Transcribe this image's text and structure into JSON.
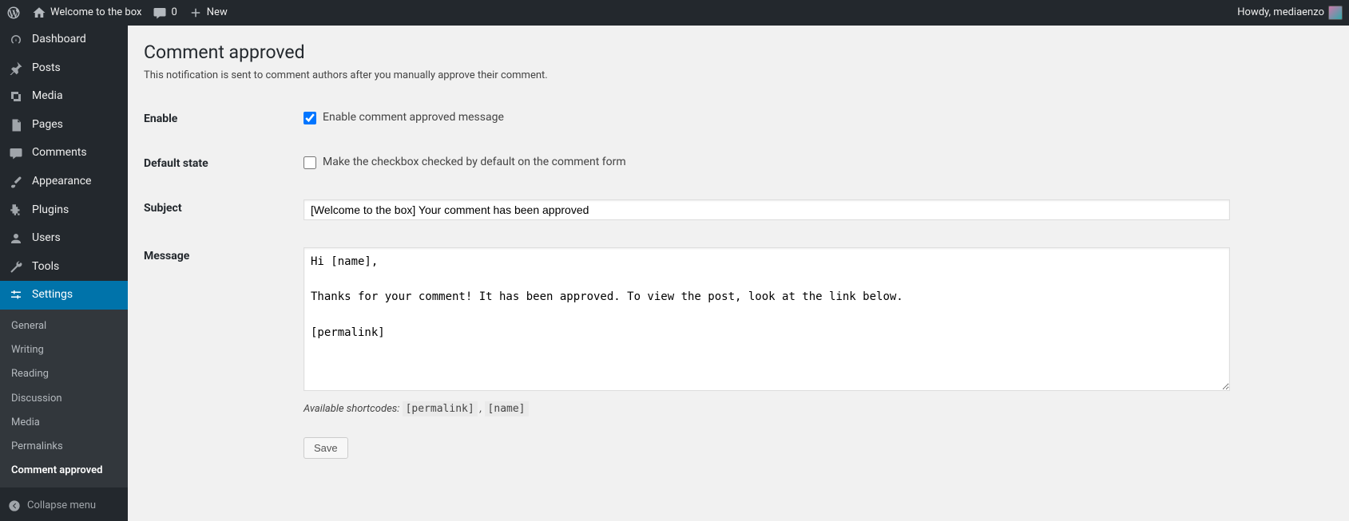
{
  "adminbar": {
    "site_name": "Welcome to the box",
    "comments_count": "0",
    "new_label": "New",
    "howdy_prefix": "Howdy, ",
    "user_name": "mediaenzo"
  },
  "sidebar": {
    "items": [
      {
        "key": "dashboard",
        "label": "Dashboard"
      },
      {
        "key": "posts",
        "label": "Posts"
      },
      {
        "key": "media",
        "label": "Media"
      },
      {
        "key": "pages",
        "label": "Pages"
      },
      {
        "key": "comments",
        "label": "Comments"
      },
      {
        "key": "appearance",
        "label": "Appearance"
      },
      {
        "key": "plugins",
        "label": "Plugins"
      },
      {
        "key": "users",
        "label": "Users"
      },
      {
        "key": "tools",
        "label": "Tools"
      },
      {
        "key": "settings",
        "label": "Settings"
      }
    ],
    "settings_submenu": [
      {
        "key": "general",
        "label": "General"
      },
      {
        "key": "writing",
        "label": "Writing"
      },
      {
        "key": "reading",
        "label": "Reading"
      },
      {
        "key": "discussion",
        "label": "Discussion"
      },
      {
        "key": "media",
        "label": "Media"
      },
      {
        "key": "permalinks",
        "label": "Permalinks"
      },
      {
        "key": "comment-approved",
        "label": "Comment approved"
      }
    ],
    "collapse_label": "Collapse menu"
  },
  "page": {
    "title": "Comment approved",
    "description": "This notification is sent to comment authors after you manually approve their comment.",
    "labels": {
      "enable": "Enable",
      "default_state": "Default state",
      "subject": "Subject",
      "message": "Message"
    },
    "fields": {
      "enable_checkbox_label": "Enable comment approved message",
      "enable_checked": true,
      "default_state_checkbox_label": "Make the checkbox checked by default on the comment form",
      "default_state_checked": false,
      "subject_value": "[Welcome to the box] Your comment has been approved",
      "message_value": "Hi [name],\n\nThanks for your comment! It has been approved. To view the post, look at the link below.\n\n[permalink]"
    },
    "shortcodes": {
      "prefix": "Available shortcodes: ",
      "list": [
        "[permalink]",
        "[name]"
      ],
      "separator": " , "
    },
    "save_label": "Save"
  }
}
